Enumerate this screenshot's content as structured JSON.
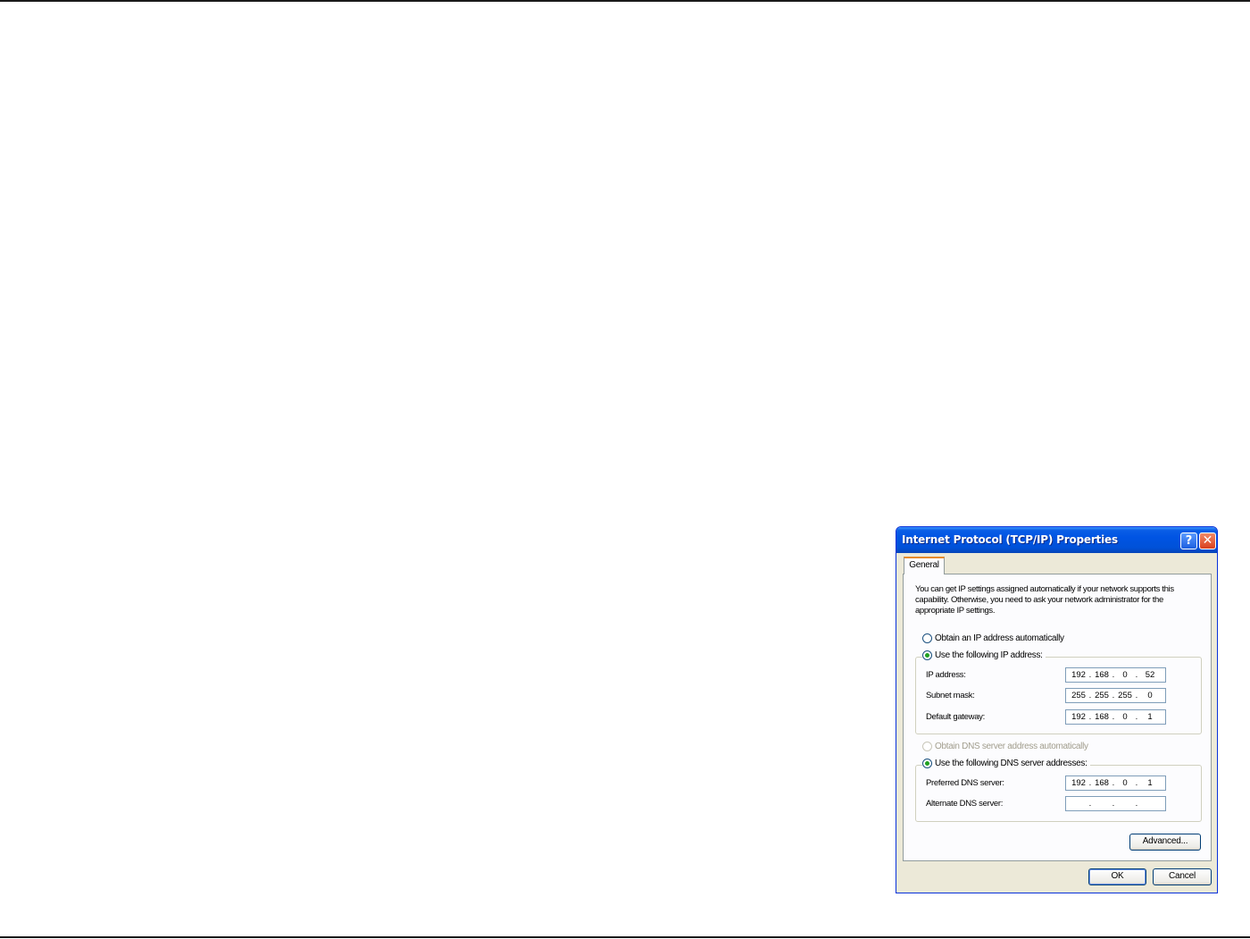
{
  "dialog": {
    "title": "Internet Protocol (TCP/IP) Properties",
    "help_glyph": "?",
    "close_glyph": "✕",
    "tabs": [
      {
        "label": "General",
        "active": true
      }
    ],
    "intro": "You can get IP settings assigned automatically if your network supports this capability. Otherwise, you need to ask your network administrator for the appropriate IP settings.",
    "ip_mode": {
      "auto_label": "Obtain an IP address automatically",
      "manual_label": "Use the following IP address:",
      "selected": "manual"
    },
    "ip_fields": {
      "ip_address": {
        "label": "IP address:",
        "octets": [
          "192",
          "168",
          "0",
          "52"
        ]
      },
      "subnet_mask": {
        "label": "Subnet mask:",
        "octets": [
          "255",
          "255",
          "255",
          "0"
        ]
      },
      "default_gateway": {
        "label": "Default gateway:",
        "octets": [
          "192",
          "168",
          "0",
          "1"
        ]
      }
    },
    "dns_mode": {
      "auto_label": "Obtain DNS server address automatically",
      "manual_label": "Use the following DNS server addresses:",
      "selected": "manual",
      "auto_disabled": true
    },
    "dns_fields": {
      "preferred": {
        "label": "Preferred DNS server:",
        "octets": [
          "192",
          "168",
          "0",
          "1"
        ]
      },
      "alternate": {
        "label": "Alternate DNS server:",
        "octets": [
          "",
          "",
          "",
          ""
        ]
      }
    },
    "buttons": {
      "advanced": "Advanced...",
      "ok": "OK",
      "cancel": "Cancel"
    }
  },
  "colors": {
    "titlebar": "#0054e3",
    "window_bg": "#ece9d8",
    "radio_selected": "#21a121",
    "tab_highlight": "#e68b2c"
  }
}
